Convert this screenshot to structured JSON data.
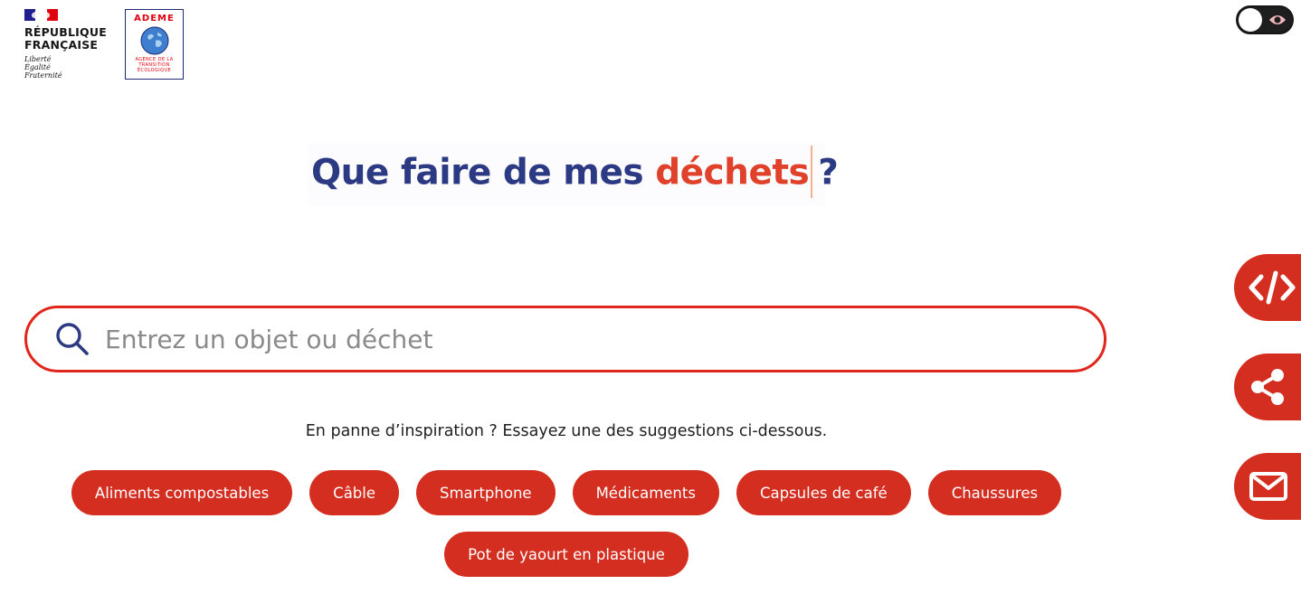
{
  "header": {
    "gov_logo": {
      "name": "RÉPUBLIQUE\nFRANÇAISE",
      "motto": "Liberté\nÉgalité\nFraternité"
    },
    "ademe_logo": {
      "name": "ADEME",
      "subtitle": "AGENCE DE LA\nTRANSITION\nÉCOLOGIQUE"
    },
    "contrast_toggle": {
      "icon": "eye-icon"
    }
  },
  "hero": {
    "title_prefix": "Que faire de mes ",
    "title_accent": "déchets",
    "title_suffix": "?"
  },
  "search": {
    "placeholder": "Entrez un objet ou déchet",
    "value": "",
    "icon": "search-icon"
  },
  "suggestions": {
    "hint": "En panne d’inspiration ? Essayez une des suggestions ci-dessous.",
    "items": [
      "Aliments compostables",
      "Câble",
      "Smartphone",
      "Médicaments",
      "Capsules de café",
      "Chaussures",
      "Pot de yaourt en plastique"
    ]
  },
  "side_actions": [
    {
      "icon": "code-icon"
    },
    {
      "icon": "share-icon"
    },
    {
      "icon": "mail-icon"
    }
  ],
  "colors": {
    "brand_red": "#d42e20",
    "search_border": "#e1261c",
    "title_blue": "#2c3983",
    "title_accent": "#e0412a"
  }
}
